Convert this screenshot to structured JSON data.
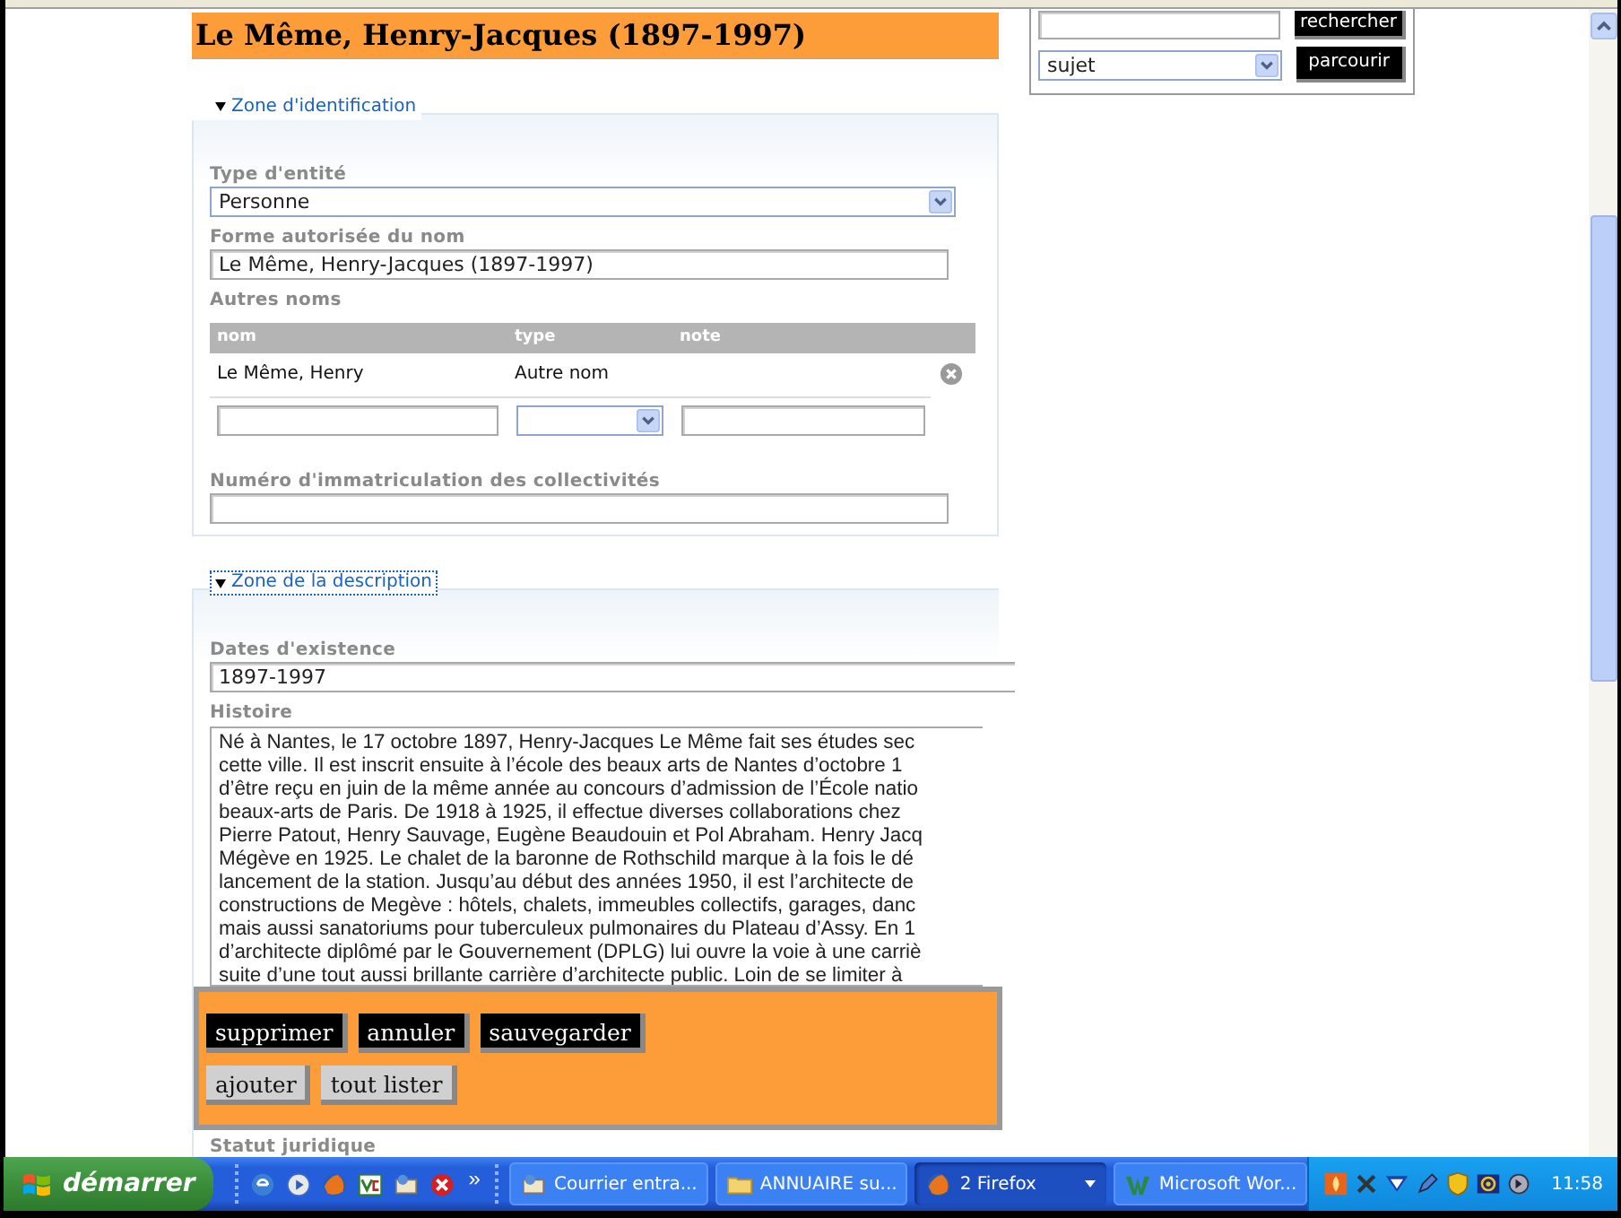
{
  "title": "Le Même, Henry-Jacques (1897-1997)",
  "search": {
    "button": "rechercher",
    "browse_select": "sujet",
    "browse_button": "parcourir"
  },
  "identification": {
    "legend": "Zone d'identification",
    "expanded": true,
    "focused": false,
    "entity_type": {
      "label": "Type d'entité",
      "value": "Personne"
    },
    "authorized_form": {
      "label": "Forme autorisée du nom",
      "value": "Le Même, Henry-Jacques (1897-1997)"
    },
    "other_names": {
      "label": "Autres noms",
      "columns": [
        "nom",
        "type",
        "note"
      ],
      "rows": [
        {
          "nom": "Le Même, Henry",
          "type": "Autre nom"
        }
      ]
    },
    "registration_number": {
      "label": "Numéro d'immatriculation des collectivités"
    }
  },
  "description": {
    "legend": "Zone de la description",
    "expanded": true,
    "focused": true,
    "dates": {
      "label": "Dates d'existence",
      "value": "1897-1997"
    },
    "history": {
      "label": "Histoire",
      "lines": [
        "Né à Nantes, le 17 octobre 1897, Henry-Jacques Le Même fait ses études sec",
        "cette ville. Il est inscrit ensuite à l’école des beaux arts de Nantes d’octobre 1",
        "d’être reçu en juin de la même année au concours d’admission de l’École natio",
        "beaux-arts de Paris. De 1918 à 1925, il effectue diverses collaborations chez",
        "Pierre Patout, Henry Sauvage, Eugène Beaudouin et Pol Abraham. Henry Jacq",
        "Mégève en 1925. Le chalet de la baronne de Rothschild marque à la fois le dé",
        "lancement de la station. Jusqu’au début des années 1950, il est l’architecte de",
        "constructions de Megève : hôtels, chalets, immeubles collectifs, garages, danc",
        "mais aussi sanatoriums pour tuberculeux pulmonaires du Plateau d’Assy. En 1",
        "d’architecte diplômé par le Gouvernement (DPLG) lui ouvre la voie à une carriè",
        "suite d’une tout aussi brillante carrière d’architecte public. Loin de se limiter à"
      ]
    },
    "legal_status": {
      "label": "Statut juridique"
    }
  },
  "actions": [
    {
      "label": "supprimer",
      "kind": "primary"
    },
    {
      "label": "annuler",
      "kind": "primary"
    },
    {
      "label": "sauvegarder",
      "kind": "primary"
    },
    {
      "label": "ajouter",
      "kind": "secondary"
    },
    {
      "label": "tout lister",
      "kind": "secondary"
    }
  ],
  "taskbar": {
    "start": "démarrer",
    "more": "»",
    "tasks": [
      {
        "label": "Courrier entra...",
        "selected": false,
        "has_menu": false
      },
      {
        "label": "ANNUAIRE su...",
        "selected": false,
        "has_menu": false
      },
      {
        "label": "2 Firefox",
        "selected": true,
        "has_menu": true
      },
      {
        "label": "Microsoft Wor...",
        "selected": false,
        "has_menu": false
      }
    ],
    "clock": "11:58"
  }
}
